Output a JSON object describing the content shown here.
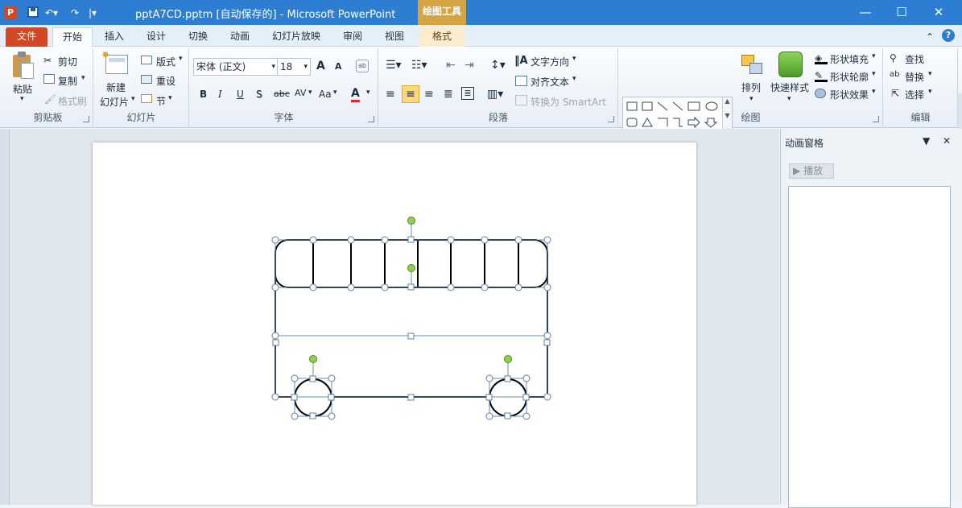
{
  "titlebar": {
    "app_logo": "P",
    "title": "pptA7CD.pptm [自动保存的] - Microsoft PowerPoint",
    "tool_header": "绘图工具",
    "minimize": "—",
    "maximize": "☐",
    "close": "✕"
  },
  "tabs": [
    {
      "label": "文件"
    },
    {
      "label": "开始"
    },
    {
      "label": "插入"
    },
    {
      "label": "设计"
    },
    {
      "label": "切换"
    },
    {
      "label": "动画"
    },
    {
      "label": "幻灯片放映"
    },
    {
      "label": "审阅"
    },
    {
      "label": "视图"
    },
    {
      "label": "格式"
    }
  ],
  "ribbon": {
    "clipboard": {
      "paste": "粘贴",
      "cut": "剪切",
      "copy": "复制",
      "format_painter": "格式刷",
      "label": "剪贴板"
    },
    "slides": {
      "new_slide_line1": "新建",
      "new_slide_line2": "幻灯片",
      "layout": "版式",
      "reset": "重设",
      "section": "节",
      "label": "幻灯片"
    },
    "font": {
      "font_name": "宋体 (正文)",
      "font_size": "18",
      "bold": "B",
      "italic": "I",
      "underline": "U",
      "shadow": "S",
      "strike": "abc",
      "spacing": "AV",
      "case": "Aa",
      "color": "A",
      "grow": "A",
      "shrink": "A",
      "label": "字体"
    },
    "paragraph": {
      "text_direction": "文字方向",
      "align_text": "对齐文本",
      "smartart": "转换为 SmartArt",
      "label": "段落"
    },
    "drawing": {
      "arrange": "排列",
      "quick_styles": "快速样式",
      "shape_fill": "形状填充",
      "shape_outline": "形状轮廓",
      "shape_effects": "形状效果",
      "label": "绘图"
    },
    "editing": {
      "find": "查找",
      "replace": "替换",
      "select": "选择",
      "label": "编辑"
    }
  },
  "anim_pane": {
    "title": "动画窗格",
    "play": "播放"
  },
  "colors": {
    "titlebar": "#2d7dd2",
    "file_tab": "#d24726",
    "tool_header": "#d5a443",
    "handle_green": "#8fd14f"
  }
}
